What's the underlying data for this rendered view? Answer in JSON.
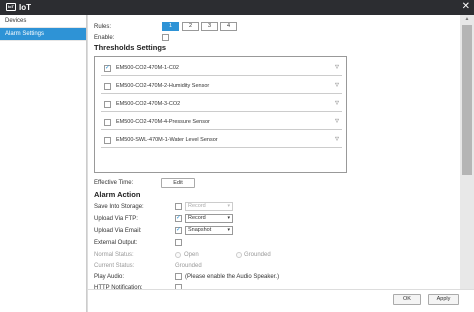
{
  "window": {
    "icon_text": "IoT",
    "title": "IoT",
    "close_glyph": "✕"
  },
  "sidebar": {
    "items": [
      {
        "label": "Devices"
      },
      {
        "label": "Alarm Settings"
      }
    ]
  },
  "rules": {
    "label": "Rules:",
    "tabs": [
      "1",
      "2",
      "3",
      "4"
    ],
    "active": "1"
  },
  "enable": {
    "label": "Enable:",
    "checked": false
  },
  "thresholds": {
    "title": "Thresholds Settings",
    "sensors": [
      {
        "name": "EM500-CO2-470M-1-C02",
        "checked": true
      },
      {
        "name": "EM500-CO2-470M-2-Humidity Sensor",
        "checked": false
      },
      {
        "name": "EM500-CO2-470M-3-CO2",
        "checked": false
      },
      {
        "name": "EM500-CO2-470M-4-Pressure Sensor",
        "checked": false
      },
      {
        "name": "EM500-SWL-470M-1-Water Level Sensor",
        "checked": false
      }
    ]
  },
  "effective_time": {
    "label": "Effective Time:",
    "button": "Edit"
  },
  "alarm_action": {
    "title": "Alarm Action",
    "save_storage": {
      "label": "Save Into Storage:",
      "checked": false,
      "value": "Record"
    },
    "upload_ftp": {
      "label": "Upload Via FTP:",
      "checked": true,
      "value": "Record"
    },
    "upload_email": {
      "label": "Upload Via Email:",
      "checked": true,
      "value": "Snapshot"
    },
    "external_output": {
      "label": "External Output:",
      "checked": false
    },
    "normal_status": {
      "label": "Normal Status:",
      "options": [
        "Open",
        "Grounded"
      ]
    },
    "current_status": {
      "label": "Current Status:",
      "value": "Grounded"
    },
    "play_audio": {
      "label": "Play Audio:",
      "checked": false,
      "note": "(Please enable the Audio Speaker.)"
    },
    "http_notification": {
      "label": "HTTP Notification:",
      "checked": false
    }
  },
  "footer": {
    "ok": "OK",
    "apply": "Apply"
  },
  "colors": {
    "accent": "#2e93d6",
    "titlebar": "#2c2d31"
  }
}
